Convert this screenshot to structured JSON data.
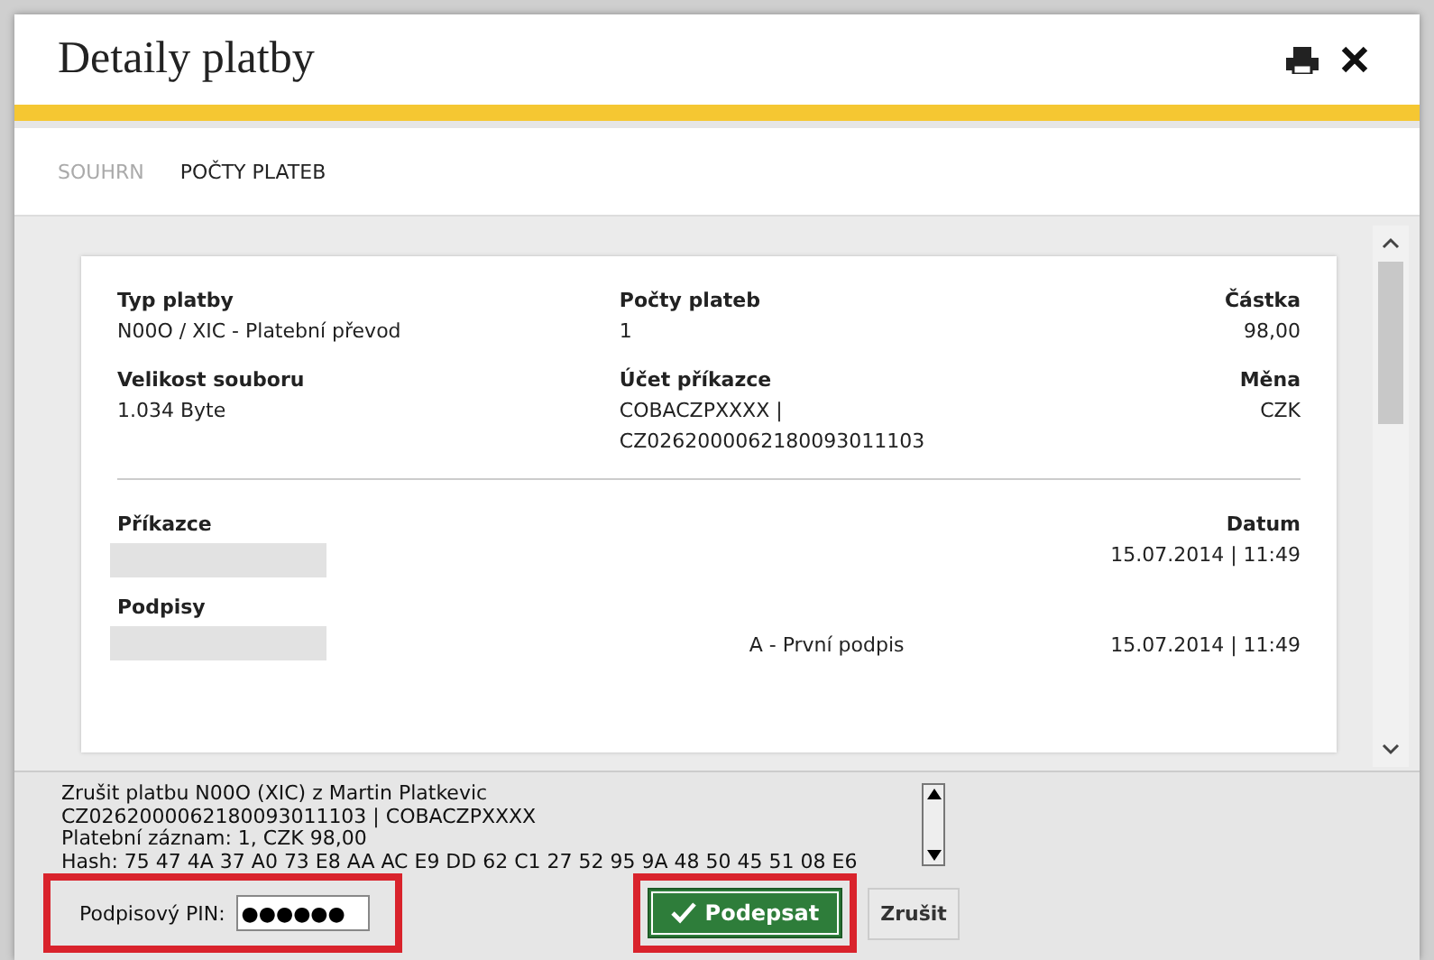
{
  "dialog": {
    "title": "Detaily platby"
  },
  "tabs": [
    {
      "label": "SOUHRN",
      "selected": true
    },
    {
      "label": "POČTY PLATEB",
      "selected": false
    }
  ],
  "summary": {
    "top": [
      {
        "label": "Typ platby",
        "lines": [
          "N00O / XIC - Platební převod"
        ]
      },
      {
        "label": "Počty plateb",
        "lines": [
          "1"
        ]
      },
      {
        "label": "Částka",
        "lines": [
          "98,00"
        ]
      },
      {
        "label": "Velikost souboru",
        "lines": [
          "1.034 Byte"
        ]
      },
      {
        "label": "Účet příkazce",
        "lines": [
          "COBACZPXXXX |",
          "CZ0262000062180093011103"
        ]
      },
      {
        "label": "Měna",
        "lines": [
          "CZK"
        ]
      }
    ],
    "orderer": {
      "label": "Příkazce",
      "date_label": "Datum",
      "date": "15.07.2014 | 11:49"
    },
    "signatures": {
      "label": "Podpisy",
      "type": "A - První podpis",
      "date": "15.07.2014 | 11:49"
    }
  },
  "sign_text": [
    "Zrušit platbu N00O (XIC) z Martin Platkevic",
    "CZ0262000062180093011103 | COBACZPXXXX",
    "Platební záznam: 1, CZK 98,00",
    "Hash: 75 47 4A 37 A0 73 E8 AA AC E9 DD 62 C1 27 52 95 9A 48 50 45 51 08 E6"
  ],
  "pin": {
    "label": "Podpisový PIN:",
    "value": "●●●●●●"
  },
  "buttons": [
    {
      "label": "Podepsat",
      "kind": "primary"
    },
    {
      "label": "Zrušit",
      "kind": "secondary"
    }
  ]
}
